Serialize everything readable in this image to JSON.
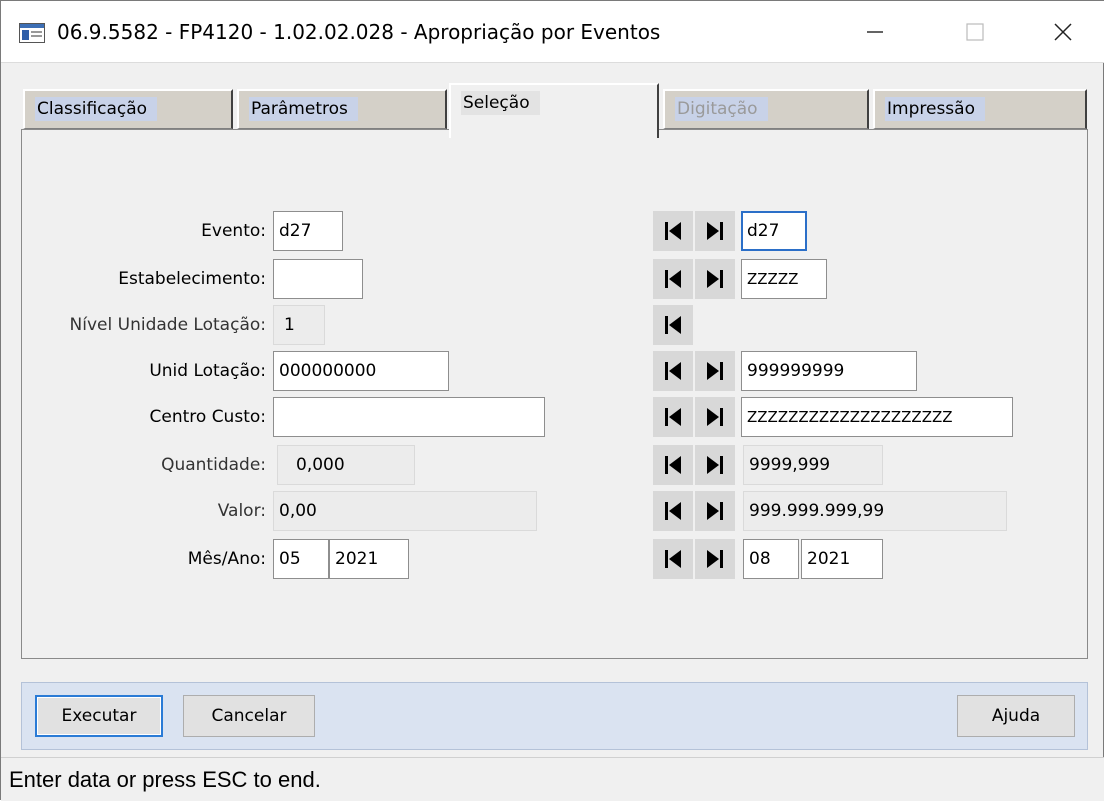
{
  "window": {
    "title": "06.9.5582 - FP4120 - 1.02.02.028 - Apropriação por Eventos"
  },
  "tabs": [
    {
      "label": "Classificação"
    },
    {
      "label": "Parâmetros"
    },
    {
      "label": "Seleção"
    },
    {
      "label": "Digitação"
    },
    {
      "label": "Impressão"
    }
  ],
  "form": {
    "evento": {
      "label": "Evento:",
      "from": "d27",
      "to": "d27"
    },
    "estabelecimento": {
      "label": "Estabelecimento:",
      "from": "",
      "to": "ZZZZZ"
    },
    "nivel": {
      "label": "Nível Unidade Lotação:",
      "value": "1"
    },
    "unid_lotacao": {
      "label": "Unid Lotação:",
      "from": "000000000",
      "to": "999999999"
    },
    "centro_custo": {
      "label": "Centro Custo:",
      "from": "",
      "to": "ZZZZZZZZZZZZZZZZZZZZ"
    },
    "quantidade": {
      "label": "Quantidade:",
      "from": "0,000",
      "to": "9999,999"
    },
    "valor": {
      "label": "Valor:",
      "from": "0,00",
      "to": "999.999.999,99"
    },
    "mes_ano": {
      "label": "Mês/Ano:",
      "from_month": "05",
      "from_year": "2021",
      "to_month": "08",
      "to_year": "2021"
    }
  },
  "buttons": {
    "executar": "Executar",
    "cancelar": "Cancelar",
    "ajuda": "Ajuda"
  },
  "status": "Enter data or press ESC to end.",
  "icons": {
    "first": "first-record-icon",
    "last": "last-record-icon"
  }
}
